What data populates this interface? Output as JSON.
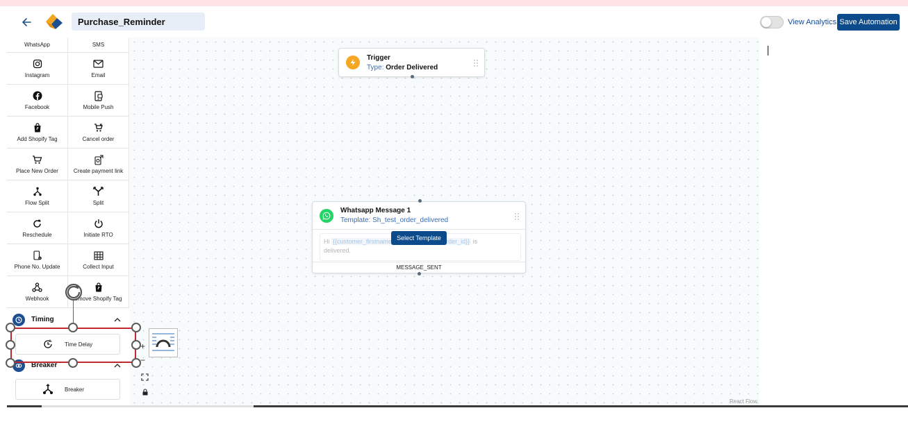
{
  "header": {
    "automation_name": "Purchase_Reminder",
    "view_analytics_label": "View Analytics",
    "save_label": "Save Automation",
    "analytics_enabled": false
  },
  "sidebar": {
    "tiles": [
      {
        "label": "WhatsApp",
        "icon": "whatsapp-icon"
      },
      {
        "label": "SMS",
        "icon": "sms-icon"
      },
      {
        "label": "Instagram",
        "icon": "instagram-icon"
      },
      {
        "label": "Email",
        "icon": "email-icon"
      },
      {
        "label": "Facebook",
        "icon": "facebook-icon"
      },
      {
        "label": "Mobile Push",
        "icon": "mobile-push-icon"
      },
      {
        "label": "Add Shopify Tag",
        "icon": "shopify-bag-icon"
      },
      {
        "label": "Cancel order",
        "icon": "cart-cancel-icon"
      },
      {
        "label": "Place New Order",
        "icon": "cart-icon"
      },
      {
        "label": "Create payment link",
        "icon": "payment-link-icon"
      },
      {
        "label": "Flow Split",
        "icon": "flow-split-icon"
      },
      {
        "label": "Split",
        "icon": "split-icon"
      },
      {
        "label": "Reschedule",
        "icon": "reschedule-icon"
      },
      {
        "label": "Initiate RTO",
        "icon": "power-icon"
      },
      {
        "label": "Phone No. Update",
        "icon": "phone-update-icon"
      },
      {
        "label": "Collect Input",
        "icon": "collect-input-icon"
      },
      {
        "label": "Webhook",
        "icon": "webhook-icon"
      },
      {
        "label": "emove Shopify Tag",
        "icon": "shopify-bag-icon"
      }
    ],
    "timing": {
      "title": "Timing",
      "item": "Time Delay"
    },
    "breaker": {
      "title": "Breaker",
      "item": "Breaker"
    }
  },
  "canvas": {
    "trigger": {
      "title": "Trigger",
      "type_key": "Type:",
      "type_value": "Order Delivered"
    },
    "whatsapp": {
      "title": "Whatsapp Message 1",
      "template": "Template: Sh_test_order_delivered",
      "preview_hi": "Hi",
      "preview_var1": "{{customer_firstname",
      "preview_var2": "{{order_id}}",
      "preview_tail": "is",
      "preview_line2": "delivered.",
      "select_template_label": "Select Template",
      "footer": "MESSAGE_SENT"
    },
    "attribution": "React Flow"
  },
  "controls": {
    "plus": "+",
    "minus": "−"
  },
  "colors": {
    "primary": "#0b4a8b",
    "selection": "#c1282d",
    "whatsapp": "#25d366",
    "trigger": "#f5a623"
  }
}
